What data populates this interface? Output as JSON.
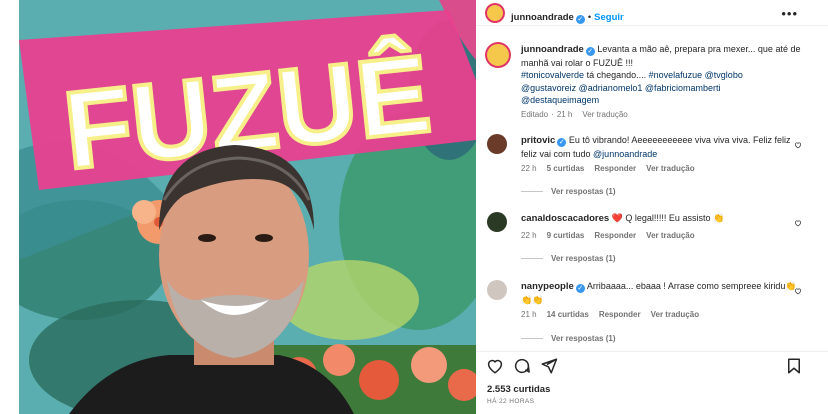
{
  "post": {
    "username": "junnoandrade",
    "follow_label": "Seguir",
    "more_icon": "more-options-icon",
    "image_text": "FUZUÊ",
    "caption": {
      "username": "junnoandrade",
      "text": "Levanta a mão aê, prepara pra mexer... que até de manhã vai rolar o FUZUÊ !!!",
      "hashtag_line": "#tonicovalverde",
      "hashtag_line_rest": "tá chegando....",
      "tags_1": "#novelafuzue @tvglobo",
      "tags_2": "@gustavoreiz @adrianomelo1 @fabriciomamberti",
      "tags_3": "@destaqueimagem",
      "edited": "Editado",
      "time": "21 h",
      "translate": "Ver tradução"
    }
  },
  "comments": [
    {
      "username": "pritovic",
      "text": "Eu tô vibrando! Aeeeeeeeeeee viva viva viva. Feliz feliz feliz vai com tudo",
      "mention": "@junnoandrade",
      "time": "22 h",
      "likes": "5 curtidas",
      "reply": "Responder",
      "translate": "Ver tradução",
      "view_replies": "Ver respostas (1)"
    },
    {
      "username": "canaldoscacadores",
      "text": "❤️ Q legal!!!!! Eu assisto 👏",
      "time": "22 h",
      "likes": "9 curtidas",
      "reply": "Responder",
      "translate": "Ver tradução",
      "view_replies": "Ver respostas (1)"
    },
    {
      "username": "nanypeople",
      "text": "Arribaaaa... ebaaa ! Arrase como sempreee kiridu👏👏👏",
      "time": "21 h",
      "likes": "14 curtidas",
      "reply": "Responder",
      "translate": "Ver tradução",
      "view_replies": "Ver respostas (1)"
    }
  ],
  "footer": {
    "likes": "2.553 curtidas",
    "posted_ago": "HÁ 22 HORAS"
  },
  "colors": {
    "accent_blue": "#0095f6",
    "verified_blue": "#3897f0",
    "link_navy": "#00376b",
    "muted_gray": "#737373",
    "lettering_pink": "#f0609e"
  }
}
